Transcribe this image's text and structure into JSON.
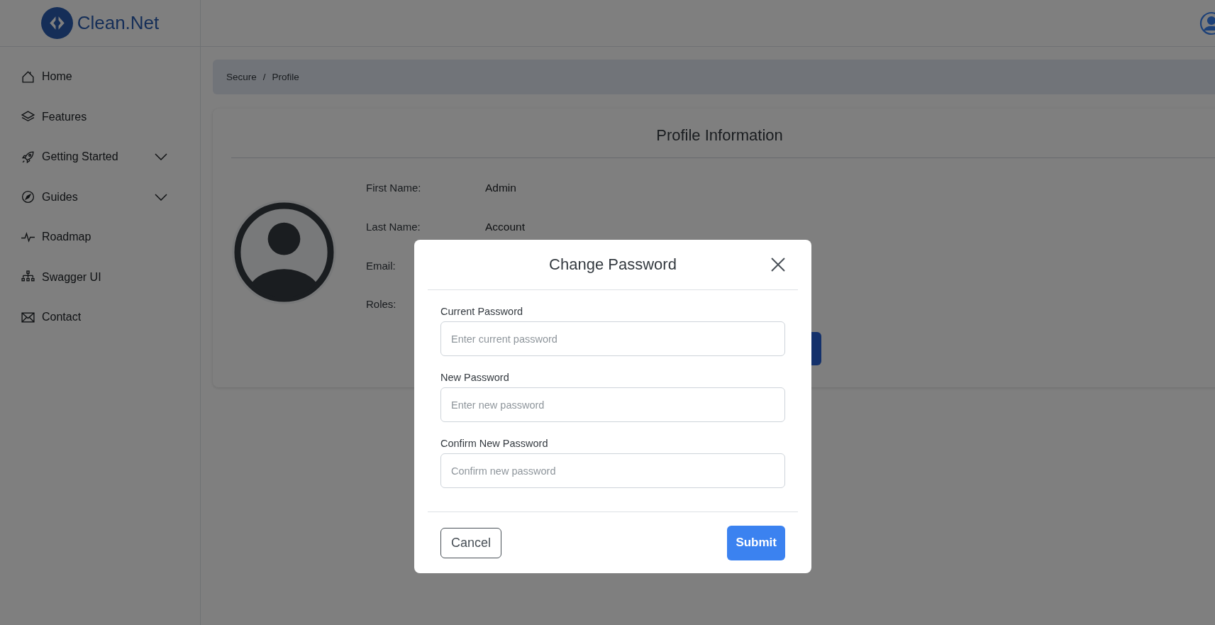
{
  "logo": {
    "text": "Clean.Net"
  },
  "sidebar": {
    "items": [
      {
        "label": "Home",
        "kind": "home",
        "submenu": false
      },
      {
        "label": "Features",
        "kind": "layers",
        "submenu": false
      },
      {
        "label": "Getting Started",
        "kind": "rocket",
        "submenu": true
      },
      {
        "label": "Guides",
        "kind": "compass",
        "submenu": true
      },
      {
        "label": "Roadmap",
        "kind": "pulse",
        "submenu": false
      },
      {
        "label": "Swagger UI",
        "kind": "network",
        "submenu": false
      },
      {
        "label": "Contact",
        "kind": "mail",
        "submenu": false
      }
    ]
  },
  "breadcrumb": {
    "items": [
      "Secure",
      "Profile"
    ],
    "separator": "/"
  },
  "profile": {
    "title": "Profile Information",
    "fields": [
      {
        "label": "First Name:",
        "value": "Admin"
      },
      {
        "label": "Last Name:",
        "value": "Account"
      },
      {
        "label": "Email:"
      },
      {
        "label": "Roles:"
      }
    ]
  },
  "modal": {
    "title": "Change Password",
    "fields": [
      {
        "label": "Current Password",
        "placeholder": "Enter current password"
      },
      {
        "label": "New Password",
        "placeholder": "Enter new password"
      },
      {
        "label": "Confirm New Password",
        "placeholder": "Confirm new password"
      }
    ],
    "cancel": "Cancel",
    "submit": "Submit"
  }
}
